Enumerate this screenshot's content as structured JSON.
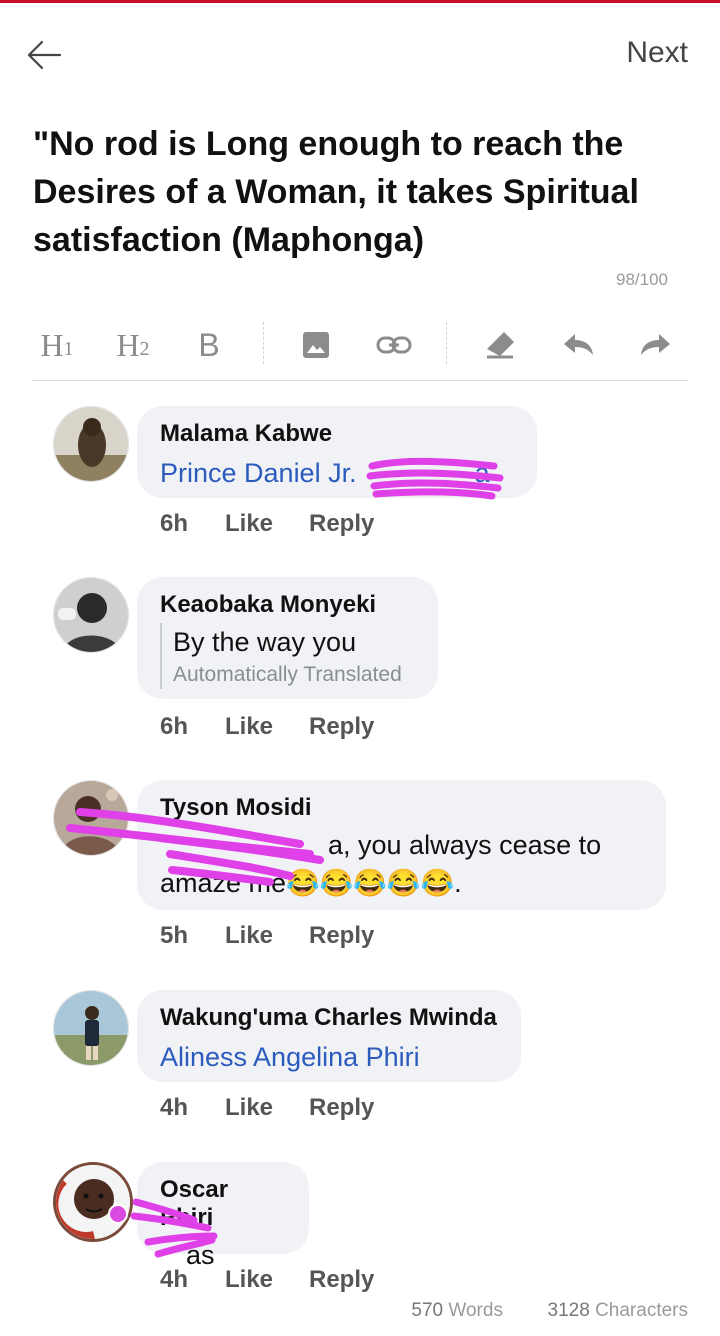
{
  "header": {
    "next_label": "Next"
  },
  "editor": {
    "title": "\"No rod is Long enough to reach the Desires of a Woman, it takes Spiritual satisfaction (Maphonga)",
    "title_counter": "98/100"
  },
  "toolbar": {
    "h1_letter": "H",
    "h1_num": "1",
    "h2_letter": "H",
    "h2_num": "2",
    "bold_label": "B",
    "icons": [
      "image-icon",
      "link-icon",
      "eraser-icon",
      "undo-icon",
      "redo-icon"
    ]
  },
  "comments": [
    {
      "name": "Malama Kabwe",
      "text": "Prince Daniel Jr.",
      "text_tail": "a",
      "time": "6h",
      "like": "Like",
      "reply": "Reply"
    },
    {
      "name": "Keaobaka Monyeki",
      "text": "By the way you",
      "translated": "Automatically Translated",
      "time": "6h",
      "like": "Like",
      "reply": "Reply"
    },
    {
      "name": "Tyson Mosidi",
      "line1": "a, you always cease to",
      "line2": "amaze me😂😂😂😂😂.",
      "time": "5h",
      "like": "Like",
      "reply": "Reply"
    },
    {
      "name": "Wakung'uma Charles Mwinda",
      "text": "Aliness Angelina Phiri",
      "time": "4h",
      "like": "Like",
      "reply": "Reply"
    },
    {
      "name": "Oscar Phiri",
      "text": "as",
      "time": "4h",
      "like": "Like",
      "reply": "Reply",
      "badge_text": "I GOT MY COVID-19 VACCINE"
    }
  ],
  "footer": {
    "words_num": "570",
    "words_label": "Words",
    "chars_num": "3128",
    "chars_label": "Characters"
  },
  "colors": {
    "accent": "#c8102e",
    "link": "#2b5cbd",
    "scribble": "#e040e8",
    "bubble": "#f0f2f5"
  }
}
